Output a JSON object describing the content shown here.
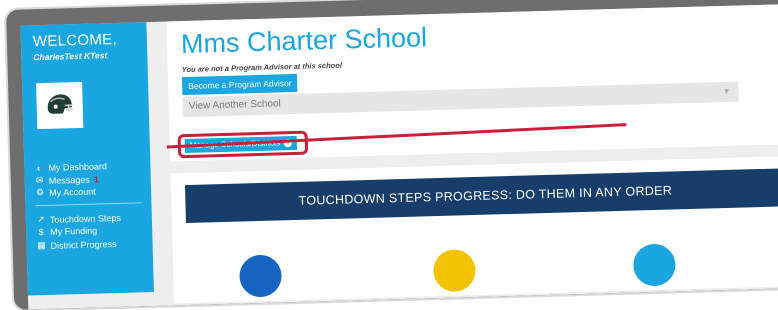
{
  "sidebar": {
    "welcome": "WELCOME,",
    "username": "CharlesTest KTest",
    "avatar_icon": "football-helmet-icon",
    "items": [
      {
        "label": "My Dashboard",
        "icon": "dashboard-icon"
      },
      {
        "label": "Messages",
        "count": "1",
        "icon": "envelope-icon"
      },
      {
        "label": "My Account",
        "icon": "gear-icon"
      },
      {
        "label": "Touchdown Steps",
        "icon": "trend-icon"
      },
      {
        "label": "My Funding",
        "icon": "dollar-icon"
      },
      {
        "label": "District Progress",
        "icon": "building-icon"
      }
    ]
  },
  "school": {
    "title": "Mms Charter School",
    "notice": "You are not a Program Advisor at this school",
    "become_advisor_label": "Become a Program Advisor",
    "view_another_placeholder": "View Another School",
    "manage_label": "Manage Schools/Districts"
  },
  "progress": {
    "heading": "TOUCHDOWN STEPS PROGRESS: DO THEM IN ANY ORDER",
    "steps": [
      {
        "color": "#1565c0"
      },
      {
        "color": "#f2c300"
      },
      {
        "color": "#1aa6e0"
      }
    ]
  },
  "colors": {
    "accent": "#1aa6e0",
    "highlight": "#c8203a",
    "header_navy": "#173e6b"
  }
}
